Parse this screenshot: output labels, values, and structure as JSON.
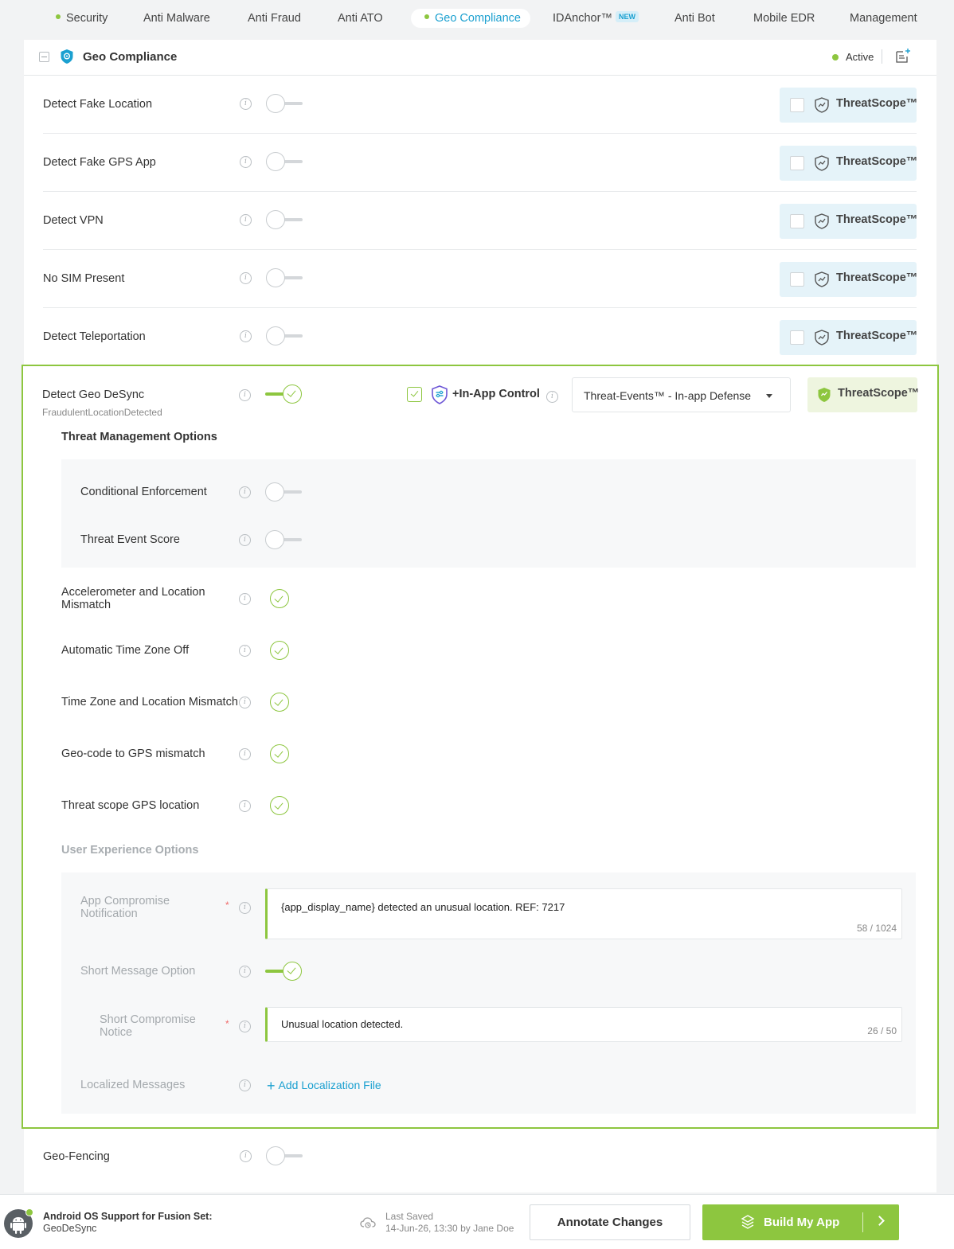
{
  "nav": {
    "tabs": [
      {
        "label": "Security"
      },
      {
        "label": "Anti Malware"
      },
      {
        "label": "Anti Fraud"
      },
      {
        "label": "Anti ATO"
      },
      {
        "label": "Geo Compliance"
      },
      {
        "label": "IDAnchor™",
        "badge": "NEW"
      },
      {
        "label": "Anti Bot"
      },
      {
        "label": "Mobile EDR"
      },
      {
        "label": "Management"
      }
    ],
    "active_tab": "Geo Compliance"
  },
  "card": {
    "title": "Geo Compliance",
    "status": "Active"
  },
  "threatscope_label": "ThreatScope™",
  "features": [
    {
      "label": "Detect Fake Location",
      "enabled": false
    },
    {
      "label": "Detect Fake GPS App",
      "enabled": false
    },
    {
      "label": "Detect VPN",
      "enabled": false
    },
    {
      "label": "No SIM Present",
      "enabled": false
    },
    {
      "label": "Detect Teleportation",
      "enabled": false
    }
  ],
  "geo_desync": {
    "label": "Detect Geo DeSync",
    "sub_label": "FraudulentLocationDetected",
    "enabled": true,
    "in_app_control_label": "+In-App Control",
    "in_app_checked": true,
    "dropdown_value": "Threat-Events™ - In-app Defense",
    "threat_mgmt_title": "Threat Management Options",
    "threat_mgmt": [
      {
        "label": "Conditional Enforcement",
        "enabled": false
      },
      {
        "label": "Threat Event Score",
        "enabled": false
      }
    ],
    "checks": [
      {
        "label": "Accelerometer and Location",
        "label2": "Mismatch"
      },
      {
        "label": "Automatic Time Zone Off"
      },
      {
        "label": "Time Zone and Location Mismatch"
      },
      {
        "label": "Geo-code to GPS mismatch"
      },
      {
        "label": "Threat scope GPS location"
      }
    ],
    "ux_title": "User Experience Options",
    "app_notification": {
      "label": "App Compromise",
      "label2": "Notification",
      "required_mark": "*",
      "value": "{app_display_name} detected an unusual location. REF: 7217",
      "count": "58 / 1024"
    },
    "short_message": {
      "label": "Short Message Option",
      "enabled": true
    },
    "short_notice": {
      "label": "Short Compromise",
      "label2": "Notice",
      "required_mark": "*",
      "value": "Unusual location detected.",
      "count": "26 / 50"
    },
    "localized": {
      "label": "Localized Messages",
      "link": "Add Localization File"
    }
  },
  "geo_fencing": {
    "label": "Geo-Fencing",
    "enabled": false
  },
  "footer": {
    "os_title": "Android OS Support for Fusion Set:",
    "os_value": "GeoDeSync",
    "last_saved_label": "Last Saved",
    "last_saved_value": "14-Jun-26, 13:30 by Jane Doe",
    "annotate_label": "Annotate Changes",
    "build_label": "Build My App"
  },
  "colors": {
    "accent_green": "#8dc63f",
    "accent_blue": "#1ba0d0",
    "threatscope_bg": "#e5f3f9"
  }
}
